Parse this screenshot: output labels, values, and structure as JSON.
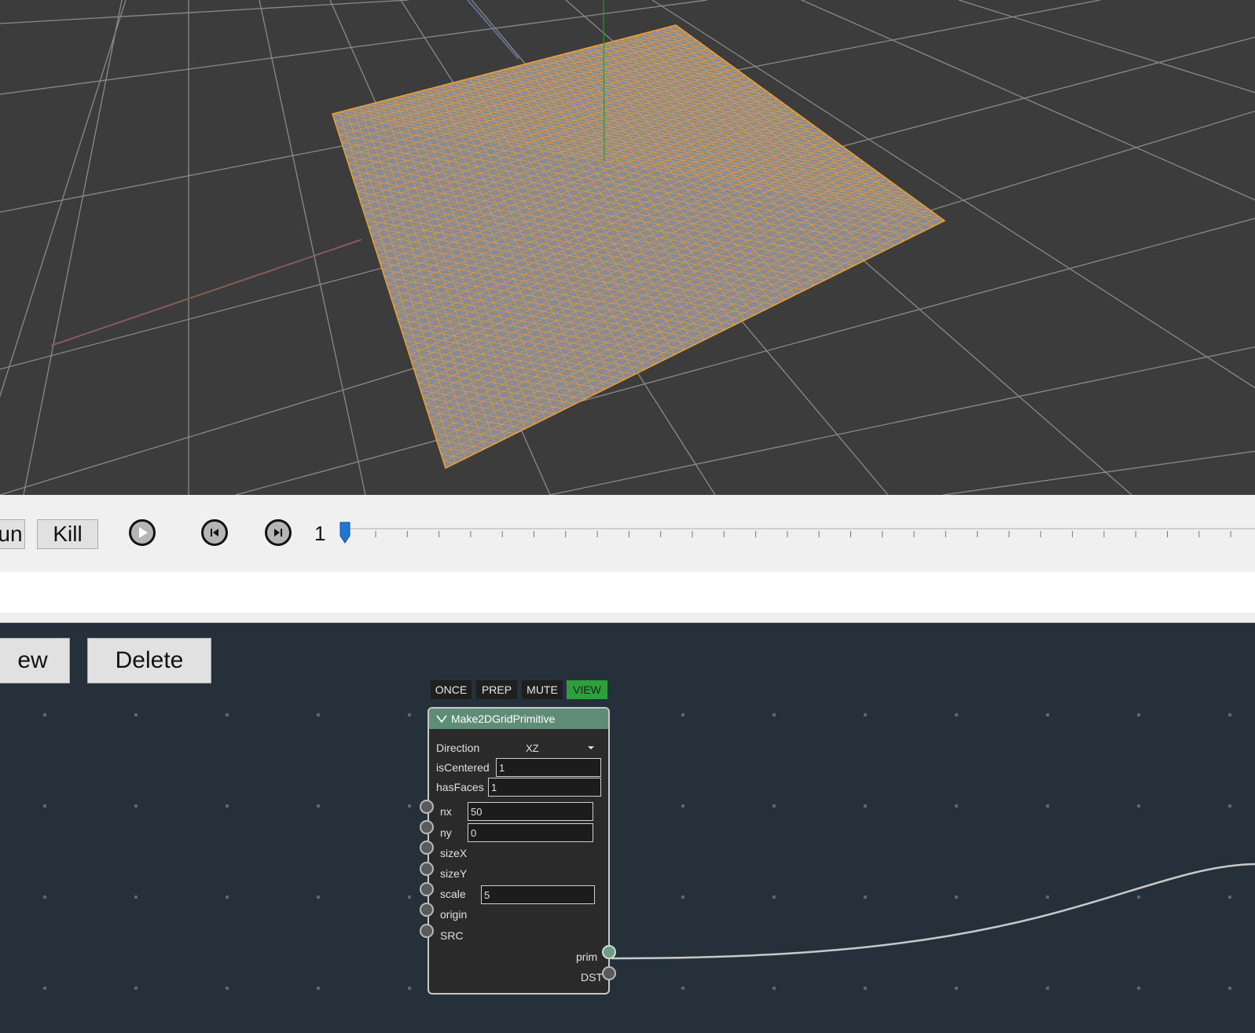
{
  "viewport": {
    "grid_color": "#8a8a8a",
    "mesh_fill": "#8a8a92",
    "mesh_stroke": "#f0a030",
    "bg_color": "#3c3c3c"
  },
  "toolbar": {
    "run_label": "un",
    "kill_label": "Kill",
    "frame_value": "1",
    "play_icon": "play-icon",
    "prev_icon": "step-back-icon",
    "next_icon": "step-forward-icon"
  },
  "graph": {
    "new_label": "ew",
    "delete_label": "Delete"
  },
  "node": {
    "flags": [
      "ONCE",
      "PREP",
      "MUTE",
      "VIEW"
    ],
    "title": "Make2DGridPrimitive",
    "collapse_icon": "chevron-down-icon",
    "params": {
      "direction_label": "Direction",
      "direction_value": "XZ",
      "iscentered_label": "isCentered",
      "iscentered_value": "1",
      "hasfaces_label": "hasFaces",
      "hasfaces_value": "1"
    },
    "inputs": {
      "nx_label": "nx",
      "nx_value": "50",
      "ny_label": "ny",
      "ny_value": "0",
      "sizex_label": "sizeX",
      "sizey_label": "sizeY",
      "scale_label": "scale",
      "scale_value": "5",
      "origin_label": "origin",
      "src_label": "SRC"
    },
    "outputs": {
      "prim_label": "prim",
      "dst_label": "DST"
    },
    "accent_color": "#5f8c76",
    "view_color": "#2f9e3d"
  }
}
